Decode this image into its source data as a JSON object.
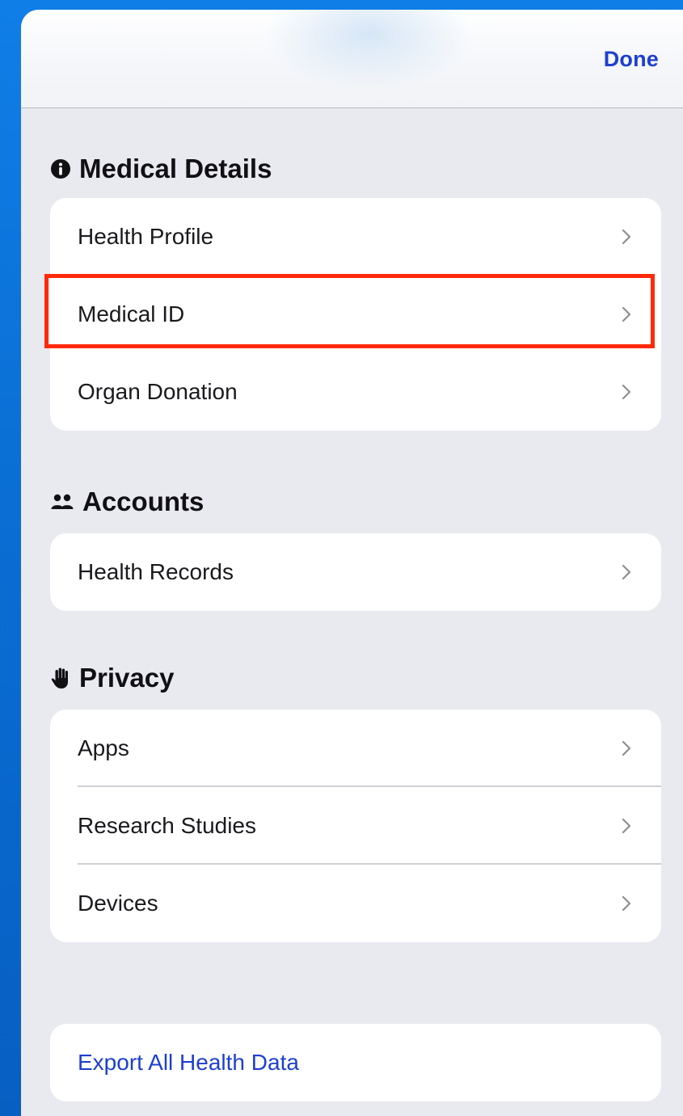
{
  "navbar": {
    "done_label": "Done"
  },
  "sections": {
    "medical": {
      "title": "Medical Details",
      "icon": "info-circle-icon",
      "items": [
        "Health Profile",
        "Medical ID",
        "Organ Donation"
      ]
    },
    "accounts": {
      "title": "Accounts",
      "icon": "people-icon",
      "items": [
        "Health Records"
      ]
    },
    "privacy": {
      "title": "Privacy",
      "icon": "hand-icon",
      "items": [
        "Apps",
        "Research Studies",
        "Devices"
      ]
    }
  },
  "export": {
    "label": "Export All Health Data"
  },
  "highlight": {
    "target": "Medical ID",
    "color": "#ff2a0a"
  },
  "colors": {
    "accent": "#1e3fd0",
    "background": "#e9e9f0",
    "frame": "#0a6fd6"
  }
}
